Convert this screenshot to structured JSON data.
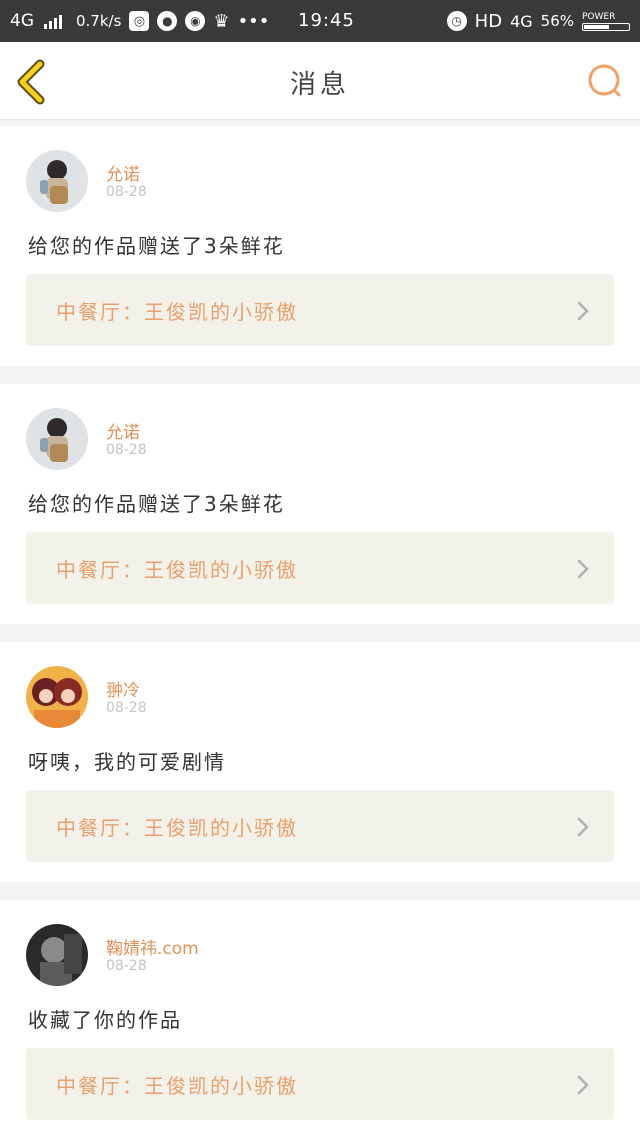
{
  "status_bar": {
    "network": "4G",
    "speed": "0.7k/s",
    "time": "19:45",
    "hd": "HD",
    "network_right": "4G",
    "battery_percent": "56%",
    "power_label": "POWER",
    "battery_level": 0.56,
    "icons": [
      "screenshot-icon",
      "qq-icon",
      "wechat-icon",
      "crown-icon",
      "more-dots-icon",
      "alarm-icon"
    ]
  },
  "header": {
    "title": "消息",
    "back_icon": "chevron-left-icon",
    "search_icon": "search-icon",
    "accent_color": "#f0a36a"
  },
  "messages": [
    {
      "username": "允诺",
      "date": "08-28",
      "text": "给您的作品赠送了3朵鲜花",
      "work_title": "中餐厅：王俊凯的小骄傲",
      "avatar": "avatar-girl-backpack"
    },
    {
      "username": "允诺",
      "date": "08-28",
      "text": "给您的作品赠送了3朵鲜花",
      "work_title": "中餐厅：王俊凯的小骄傲",
      "avatar": "avatar-girl-backpack"
    },
    {
      "username": "翀冷",
      "date": "08-28",
      "text": "呀咦，我的可爱剧情",
      "work_title": "中餐厅：王俊凯的小骄傲",
      "avatar": "avatar-anime-girls"
    },
    {
      "username": "鞠婧祎.com",
      "date": "08-28",
      "text": "收藏了你的作品",
      "work_title": "中餐厅：王俊凯的小骄傲",
      "avatar": "avatar-dark-portrait"
    }
  ]
}
